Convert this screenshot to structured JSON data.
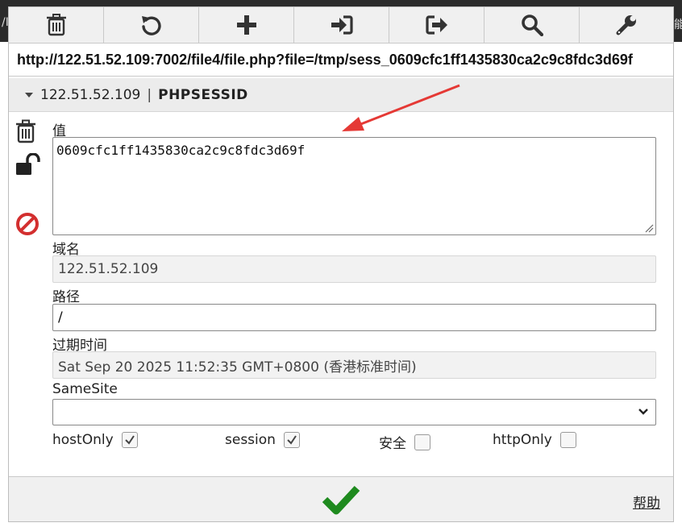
{
  "background": {
    "left_text": "/I",
    "right_text": "能"
  },
  "toolbar": {
    "buttons": [
      {
        "icon": "trash-icon"
      },
      {
        "icon": "undo-icon"
      },
      {
        "icon": "plus-icon"
      },
      {
        "icon": "import-icon"
      },
      {
        "icon": "export-icon"
      },
      {
        "icon": "search-icon"
      },
      {
        "icon": "wrench-icon"
      }
    ]
  },
  "url": "http://122.51.52.109:7002/file4/file.php?file=/tmp/sess_0609cfc1ff1435830ca2c9c8fdc3d69f",
  "cookie": {
    "domain_header": "122.51.52.109",
    "separator": "|",
    "name": "PHPSESSID",
    "value_label": "值",
    "value": "0609cfc1ff1435830ca2c9c8fdc3d69f",
    "domain_label": "域名",
    "domain": "122.51.52.109",
    "path_label": "路径",
    "path": "/",
    "expiry_label": "过期时间",
    "expiry": "Sat Sep 20 2025 11:52:35 GMT+0800 (香港标准时间)",
    "samesite_label": "SameSite",
    "samesite_value": "",
    "checkboxes": [
      {
        "label": "hostOnly",
        "checked": true
      },
      {
        "label": "session",
        "checked": true
      },
      {
        "label": "安全",
        "checked": false
      },
      {
        "label": "httpOnly",
        "checked": false
      }
    ]
  },
  "side_icons": [
    "trash-icon",
    "unlock-icon",
    "block-icon"
  ],
  "footer": {
    "help_label": "帮助"
  },
  "colors": {
    "annotation_arrow": "#e53935",
    "ok_check": "#1e8a1e",
    "block_icon": "#d32f2f"
  }
}
